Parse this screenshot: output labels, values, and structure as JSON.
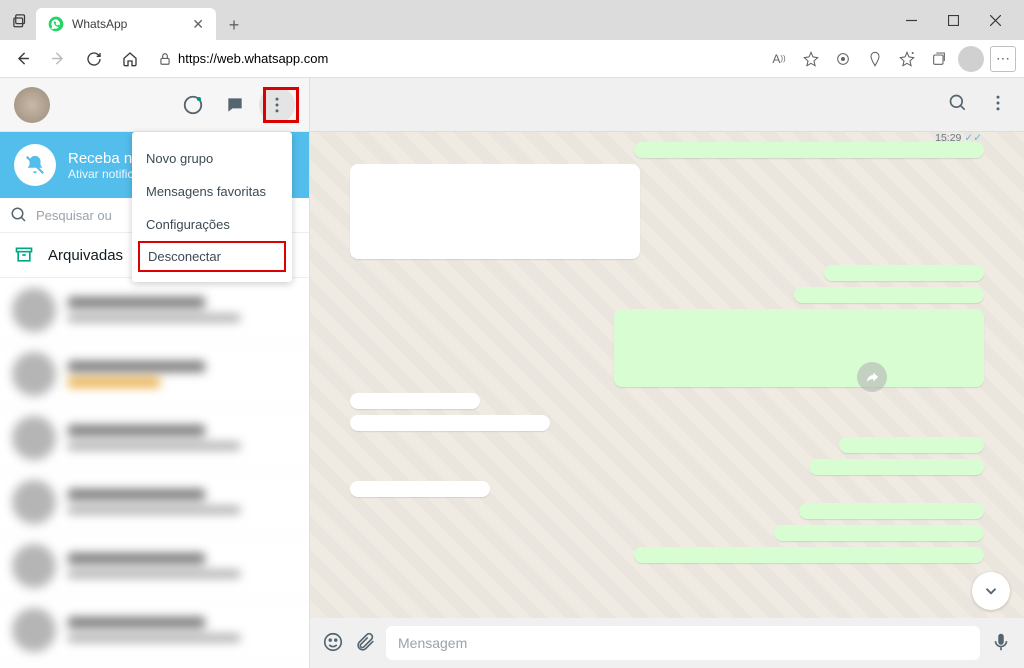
{
  "browser": {
    "tab_title": "WhatsApp",
    "url": "https://web.whatsapp.com"
  },
  "sidebar": {
    "notif_title": "Receba noti",
    "notif_subtitle": "Ativar notifica",
    "search_placeholder": "Pesquisar ou",
    "archived_label": "Arquivadas"
  },
  "menu": {
    "items": [
      "Novo grupo",
      "Mensagens favoritas",
      "Configurações",
      "Desconectar"
    ]
  },
  "chat": {
    "timestamp": "15:29",
    "compose_placeholder": "Mensagem"
  }
}
